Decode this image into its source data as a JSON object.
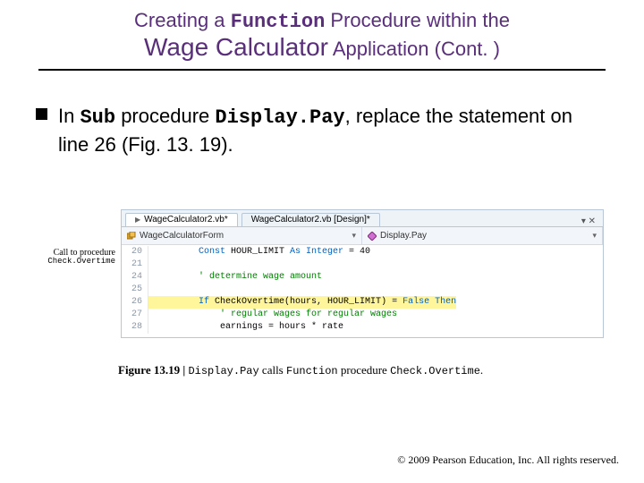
{
  "title": {
    "pre": "Creating a ",
    "mono": "Function",
    "post": " Procedure within the",
    "line2_big": "Wage Calculator",
    "line2_post": " Application (Cont. )"
  },
  "bullet": {
    "t1": "In ",
    "m1": "Sub",
    "t2": " procedure ",
    "m2": "Display.Pay",
    "t3": ", replace the statement on line 26 (Fig. 13. 19)."
  },
  "callout": {
    "l1": "Call to procedure",
    "l2": "Check.Overtime"
  },
  "ide": {
    "tab_active": "WageCalculator2.vb*",
    "tab_inactive": "WageCalculator2.vb [Design]*",
    "left_sel": "WageCalculatorForm",
    "right_sel": "Display.Pay",
    "code": {
      "l20n": "20",
      "l20": "        Const HOUR_LIMIT As Integer = 40",
      "l21n": "21",
      "l21": "",
      "l24n": "24",
      "l24": "        ' determine wage amount",
      "l25n": "25",
      "l25": "",
      "l26n": "26",
      "l26_pre": "        ",
      "l26_kw1": "If",
      "l26_mid": " CheckOvertime(hours, HOUR_LIMIT) = ",
      "l26_kw2": "False Then",
      "l27n": "27",
      "l27": "            ' regular wages for regular wages",
      "l28n": "28",
      "l28": "            earnings = hours * rate"
    }
  },
  "caption": {
    "figno": "Figure 13.19 | ",
    "m1": "Display.Pay",
    "t1": " calls ",
    "m2": "Function",
    "t2": " procedure ",
    "m3": "Check.Overtime",
    "t3": "."
  },
  "footer": "  2009 Pearson Education, Inc.  All rights reserved."
}
